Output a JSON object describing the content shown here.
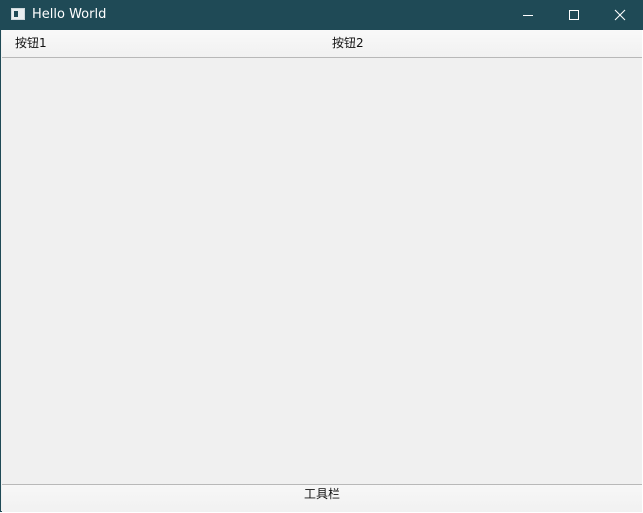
{
  "window": {
    "title": "Hello World",
    "titlebar_color": "#1f4a56",
    "controls": {
      "minimize_icon": "minimize-icon",
      "maximize_icon": "maximize-icon",
      "close_icon": "close-icon"
    }
  },
  "top_toolbar": {
    "button1_label": "按钮1",
    "button2_label": "按钮2"
  },
  "bottom_toolbar": {
    "label": "工具栏"
  },
  "colors": {
    "window_background": "#f0f0f0",
    "separator": "#b8b8b8"
  }
}
